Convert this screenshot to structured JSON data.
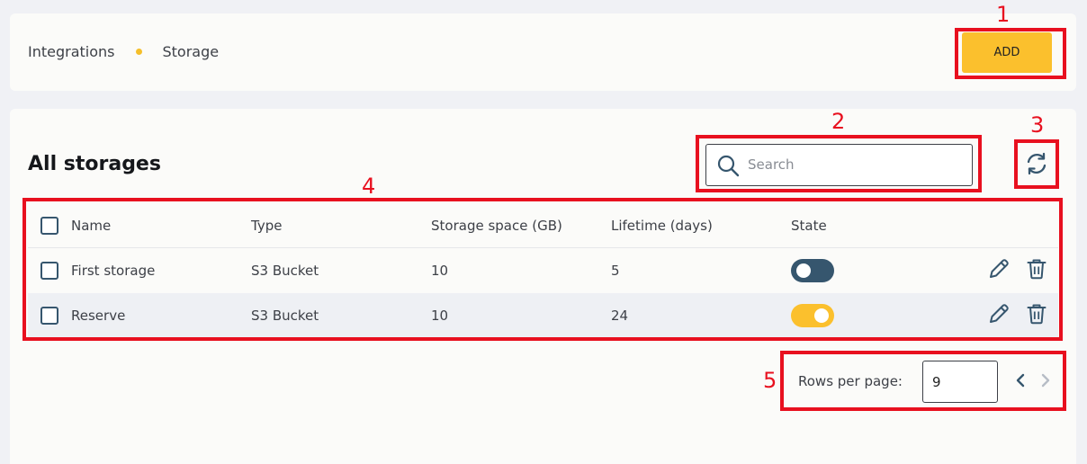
{
  "breadcrumb": {
    "items": [
      "Integrations",
      "Storage"
    ]
  },
  "header": {
    "add_label": "ADD"
  },
  "main": {
    "title": "All storages",
    "search": {
      "placeholder": "Search",
      "value": ""
    }
  },
  "table": {
    "columns": [
      "Name",
      "Type",
      "Storage space (GB)",
      "Lifetime (days)",
      "State"
    ],
    "rows": [
      {
        "name": "First storage",
        "type": "S3 Bucket",
        "space": "10",
        "lifetime": "5",
        "state": "off"
      },
      {
        "name": "Reserve",
        "type": "S3 Bucket",
        "space": "10",
        "lifetime": "24",
        "state": "on"
      }
    ]
  },
  "pagination": {
    "rows_per_page_label": "Rows per page:",
    "rows_per_page_value": "9"
  },
  "annotations": [
    "1",
    "2",
    "3",
    "4",
    "5"
  ],
  "colors": {
    "accent": "#fbc02d",
    "dark": "#36566e",
    "annotation": "#e8101f"
  },
  "icons": [
    "search-icon",
    "refresh-icon",
    "edit-icon",
    "delete-icon",
    "chevron-left-icon",
    "chevron-right-icon"
  ]
}
